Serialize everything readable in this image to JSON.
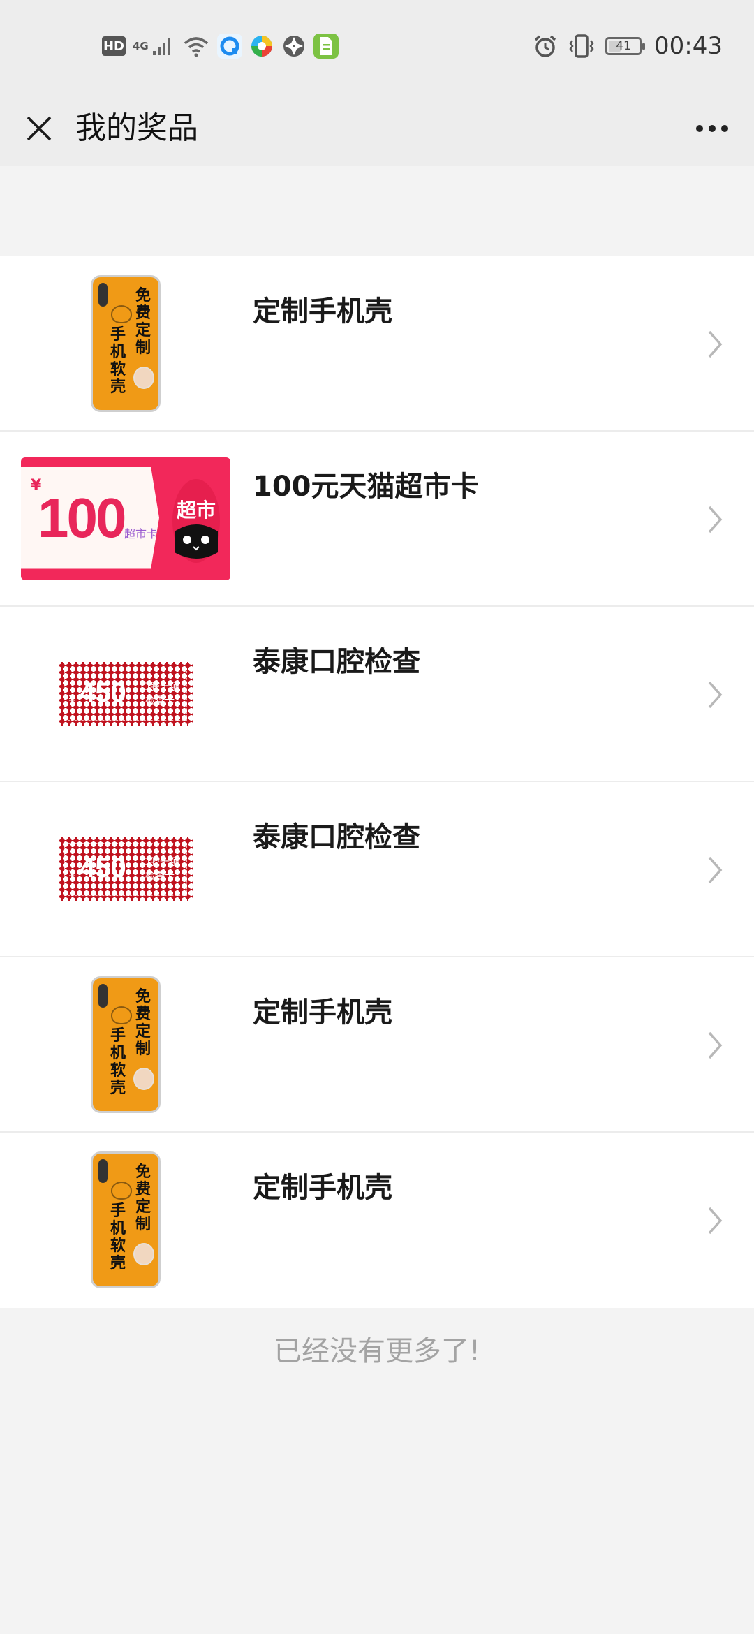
{
  "status_bar": {
    "hd_label": "HD",
    "network_label": "4G",
    "battery_level": "41",
    "battery_fraction": 0.41,
    "time": "00:43",
    "icons": [
      "signal-icon",
      "wifi-icon",
      "app-browser-icon",
      "app-colorwheel-icon",
      "app-aperture-icon",
      "app-document-icon",
      "alarm-icon",
      "vibrate-icon",
      "battery-icon"
    ]
  },
  "nav": {
    "title": "我的奖品",
    "close_icon": "close-icon",
    "more_icon": "more-icon"
  },
  "prizes": [
    {
      "name": "定制手机壳",
      "thumb": "phone-case",
      "case_right_text": "免费定制",
      "case_left_text": "手机软壳"
    },
    {
      "name": "100元天猫超市卡",
      "thumb": "tmall-card",
      "card_yen": "¥",
      "card_amount": "100",
      "card_label": "超市卡",
      "card_logo_text": "超市"
    },
    {
      "name": "泰康口腔检查",
      "thumb": "dental-coupon",
      "coupon_yen": "¥",
      "coupon_amount": "450",
      "coupon_text_1": "口腔十项",
      "coupon_text_2": "检查卡"
    },
    {
      "name": "泰康口腔检查",
      "thumb": "dental-coupon",
      "coupon_yen": "¥",
      "coupon_amount": "450",
      "coupon_text_1": "口腔十项",
      "coupon_text_2": "检查卡"
    },
    {
      "name": "定制手机壳",
      "thumb": "phone-case",
      "case_right_text": "免费定制",
      "case_left_text": "手机软壳"
    },
    {
      "name": "定制手机壳",
      "thumb": "phone-case",
      "case_right_text": "免费定制",
      "case_left_text": "手机软壳"
    }
  ],
  "footer": {
    "end_text": "已经没有更多了!"
  },
  "colors": {
    "background": "#f3f3f3",
    "header_background": "#ededed",
    "case_orange": "#f09a16",
    "tmall_red": "#f2285a",
    "coupon_red": "#c0131f",
    "end_text_gray": "#a3a3a3"
  }
}
